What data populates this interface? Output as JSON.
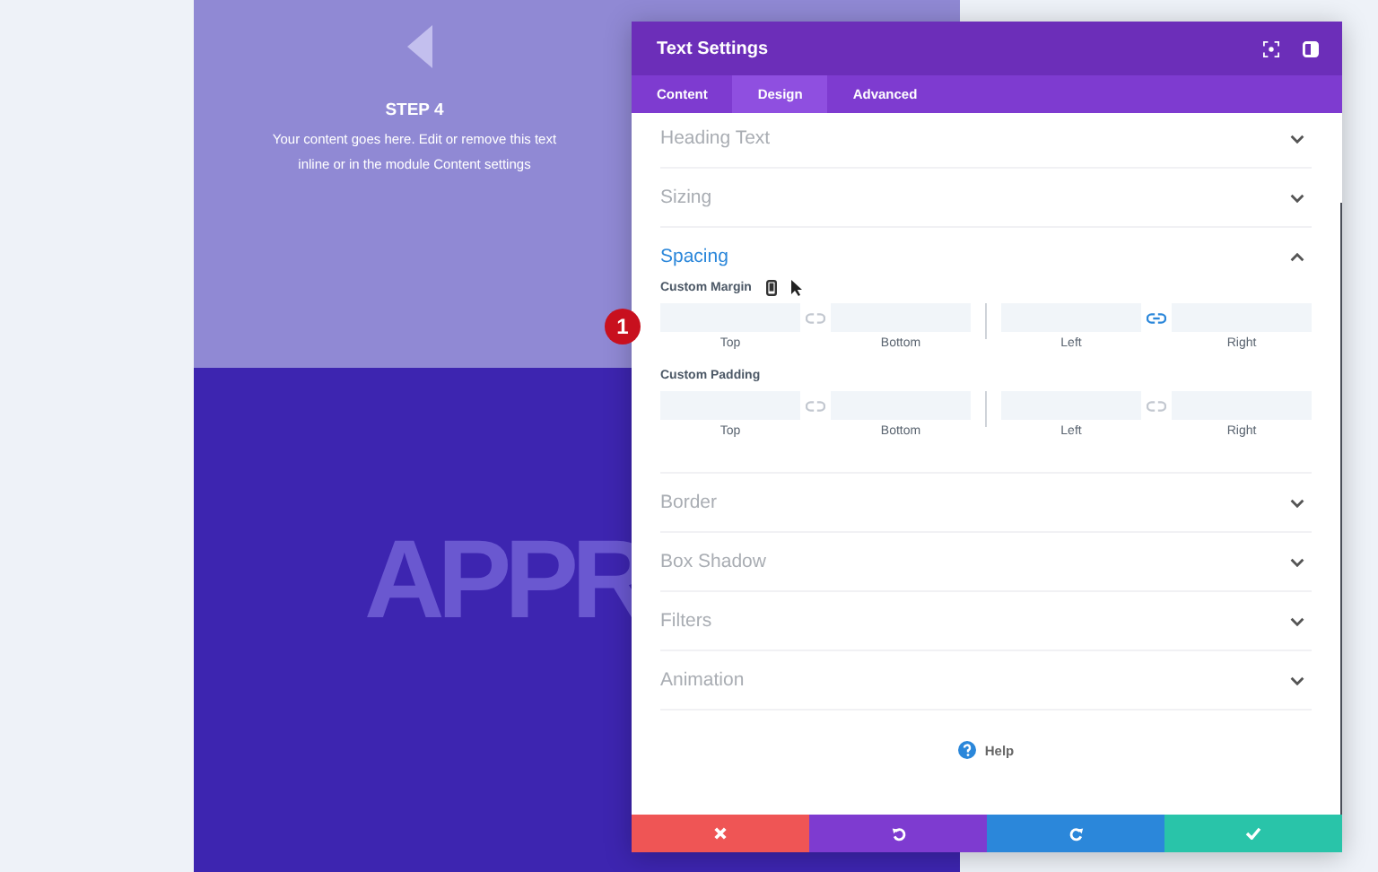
{
  "page": {
    "step_title": "STEP 4",
    "step_text": "Your content goes here. Edit or remove this text inline or in the module Content settings",
    "big_text": "APPR"
  },
  "panel": {
    "title": "Text Settings",
    "tabs": [
      {
        "label": "Content",
        "selected": false
      },
      {
        "label": "Design",
        "selected": true
      },
      {
        "label": "Advanced",
        "selected": false
      }
    ],
    "sections": [
      {
        "title": "Heading Text",
        "expanded": false
      },
      {
        "title": "Sizing",
        "expanded": false
      },
      {
        "title": "Spacing",
        "expanded": true,
        "groups": [
          {
            "label": "Custom Margin",
            "responsive_icon": true,
            "pairs": [
              {
                "labels": [
                  "Top",
                  "Bottom"
                ],
                "linked": false
              },
              {
                "labels": [
                  "Left",
                  "Right"
                ],
                "linked": true
              }
            ]
          },
          {
            "label": "Custom Padding",
            "responsive_icon": false,
            "pairs": [
              {
                "labels": [
                  "Top",
                  "Bottom"
                ],
                "linked": false
              },
              {
                "labels": [
                  "Left",
                  "Right"
                ],
                "linked": false
              }
            ]
          }
        ]
      },
      {
        "title": "Border",
        "expanded": false
      },
      {
        "title": "Box Shadow",
        "expanded": false
      },
      {
        "title": "Filters",
        "expanded": false
      },
      {
        "title": "Animation",
        "expanded": false
      }
    ],
    "help": "Help",
    "footer": [
      {
        "kind": "cancel"
      },
      {
        "kind": "undo"
      },
      {
        "kind": "redo"
      },
      {
        "kind": "save"
      }
    ]
  },
  "marker": "1"
}
